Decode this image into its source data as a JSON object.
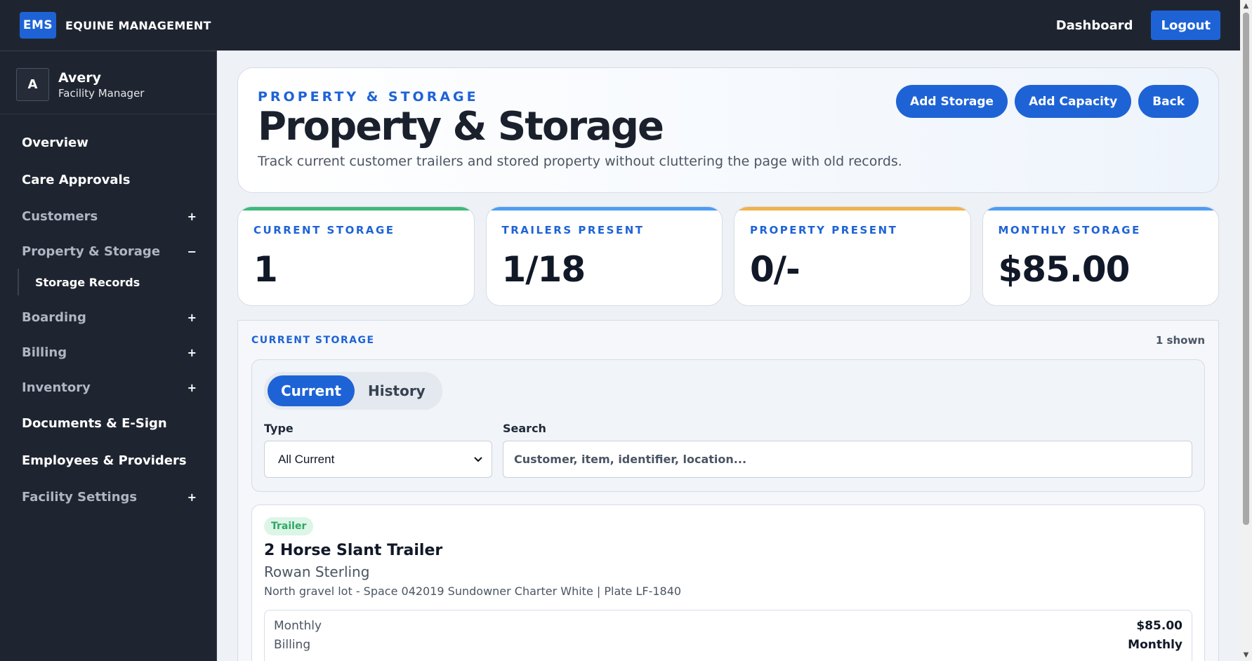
{
  "topbar": {
    "logo": "EMS",
    "brand": "EQUINE MANAGEMENT",
    "dashboard": "Dashboard",
    "logout": "Logout"
  },
  "user": {
    "initial": "A",
    "name": "Avery",
    "role": "Facility Manager"
  },
  "nav": {
    "overview": "Overview",
    "care_approvals": "Care Approvals",
    "customers": "Customers",
    "property_storage": "Property & Storage",
    "storage_records": "Storage Records",
    "boarding": "Boarding",
    "billing": "Billing",
    "inventory": "Inventory",
    "documents": "Documents & E-Sign",
    "employees": "Employees & Providers",
    "facility_settings": "Facility Settings",
    "plus": "+",
    "minus": "−"
  },
  "hero": {
    "eyebrow": "PROPERTY & STORAGE",
    "title": "Property & Storage",
    "subtitle": "Track current customer trailers and stored property without cluttering the page with old records.",
    "add_storage": "Add Storage",
    "add_capacity": "Add Capacity",
    "back": "Back"
  },
  "stats": [
    {
      "label": "CURRENT STORAGE",
      "value": "1",
      "accent": "#3fb97a"
    },
    {
      "label": "TRAILERS PRESENT",
      "value": "1/18",
      "accent": "#4f9cf2"
    },
    {
      "label": "PROPERTY PRESENT",
      "value": "0/-",
      "accent": "#f0b24a"
    },
    {
      "label": "MONTHLY STORAGE",
      "value": "$85.00",
      "accent": "#4f9cf2"
    }
  ],
  "panel": {
    "title": "CURRENT STORAGE",
    "count": "1 shown",
    "tabs": {
      "current": "Current",
      "history": "History"
    },
    "type_label": "Type",
    "type_value": "All Current",
    "search_label": "Search",
    "search_placeholder": "Customer, item, identifier, location..."
  },
  "record": {
    "tag": "Trailer",
    "title": "2 Horse Slant Trailer",
    "customer": "Rowan Sterling",
    "detail": "North gravel lot - Space 042019 Sundowner Charter White | Plate LF-1840",
    "rows": [
      {
        "key": "Monthly",
        "value": "$85.00"
      },
      {
        "key": "Billing",
        "value": "Monthly"
      }
    ]
  }
}
